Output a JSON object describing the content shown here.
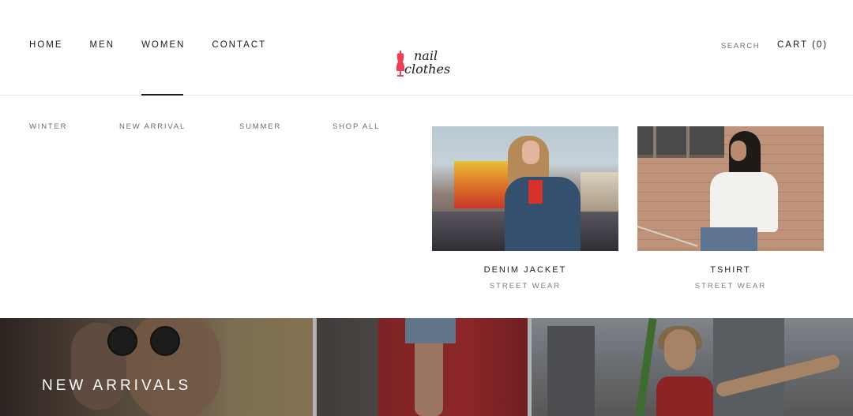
{
  "nav": {
    "items": [
      {
        "label": "HOME"
      },
      {
        "label": "MEN"
      },
      {
        "label": "WOMEN"
      },
      {
        "label": "CONTACT"
      }
    ]
  },
  "logo": {
    "line1": "nail",
    "line2": "clothes"
  },
  "header": {
    "search": "SEARCH",
    "cart": "CART (0)"
  },
  "submenu": {
    "items": [
      {
        "label": "WINTER"
      },
      {
        "label": "NEW ARRIVAL"
      },
      {
        "label": "SUMMER"
      },
      {
        "label": "SHOP ALL"
      }
    ]
  },
  "products": [
    {
      "title": "DENIM JACKET",
      "subtitle": "STREET WEAR"
    },
    {
      "title": "TSHIRT",
      "subtitle": "STREET WEAR"
    }
  ],
  "banner": {
    "title": "NEW ARRIVALS"
  },
  "colors": {
    "accent": "#e8415a",
    "text": "#1c1c1c",
    "muted": "#6b6b6b"
  },
  "icons": {
    "logo": "dress-form-icon"
  }
}
